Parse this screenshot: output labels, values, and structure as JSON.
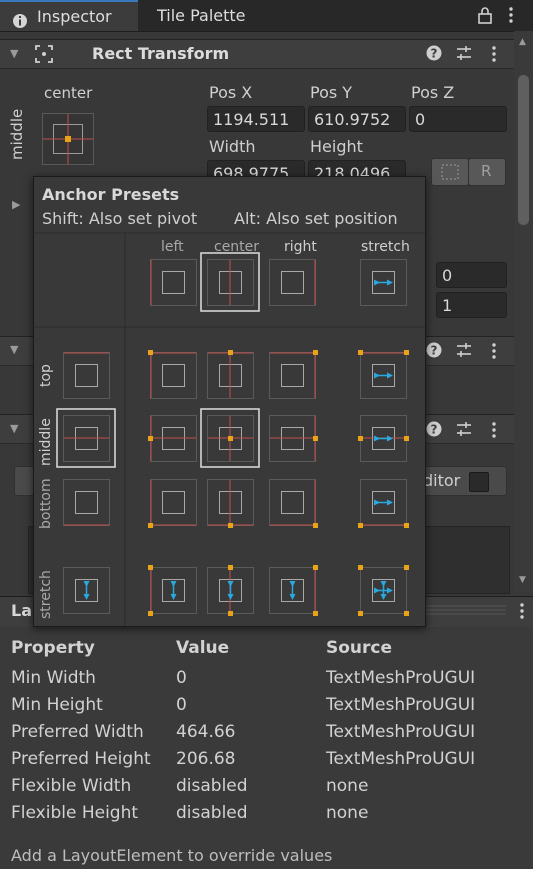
{
  "tabs": [
    {
      "label": "Inspector"
    },
    {
      "label": "Tile Palette"
    }
  ],
  "rect_transform": {
    "title": "Rect Transform",
    "anchor_h": "center",
    "anchor_v": "middle",
    "labels": {
      "pos_x": "Pos X",
      "pos_y": "Pos Y",
      "pos_z": "Pos Z",
      "width": "Width",
      "height": "Height"
    },
    "values": {
      "pos_x": "1194.511",
      "pos_y": "610.9752",
      "pos_z": "0",
      "width": "698.9775",
      "height": "218.0496"
    },
    "r_button": "R",
    "field_a": "0",
    "field_b": "1"
  },
  "hidden_component": {
    "field_label": "ditor"
  },
  "anchor_presets": {
    "title": "Anchor Presets",
    "hint_shift": "Shift: Also set pivot",
    "hint_alt": "Alt: Also set position",
    "columns": [
      "left",
      "center",
      "right",
      "stretch"
    ],
    "rows": [
      "top",
      "middle",
      "bottom",
      "stretch"
    ]
  },
  "layout_panel": {
    "title": "La",
    "headers": {
      "property": "Property",
      "value": "Value",
      "source": "Source"
    },
    "rows": [
      {
        "property": "Min Width",
        "value": "0",
        "source": "TextMeshProUGUI"
      },
      {
        "property": "Min Height",
        "value": "0",
        "source": "TextMeshProUGUI"
      },
      {
        "property": "Preferred Width",
        "value": "464.66",
        "source": "TextMeshProUGUI"
      },
      {
        "property": "Preferred Height",
        "value": "206.68",
        "source": "TextMeshProUGUI"
      },
      {
        "property": "Flexible Width",
        "value": "disabled",
        "source": "none"
      },
      {
        "property": "Flexible Height",
        "value": "disabled",
        "source": "none"
      }
    ],
    "footer": "Add a LayoutElement to override values"
  },
  "icons": [
    "lock-icon",
    "kebab-menu-icon",
    "rect-transform-icon",
    "help-icon",
    "settings-sliders-icon",
    "blueprint-icon"
  ],
  "colors": {
    "accent": "#3a79bb",
    "anchor_line": "#c0504d",
    "pivot": "#e8a317",
    "stretch_arrow": "#2aa9e0"
  }
}
